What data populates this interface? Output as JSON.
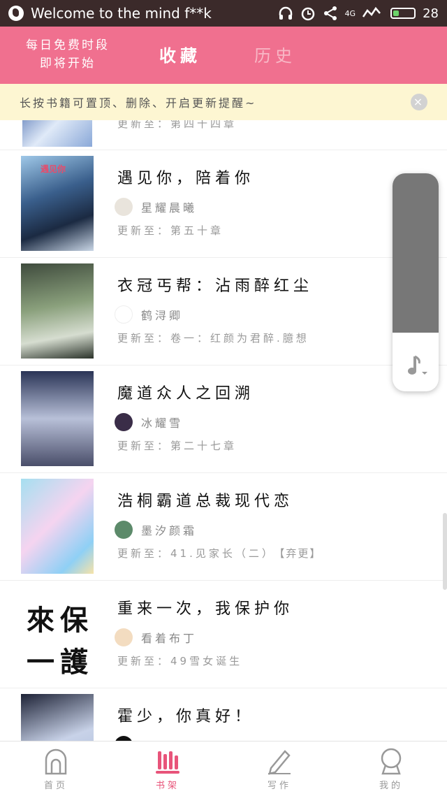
{
  "status_bar": {
    "app_text": "Welcome to the mind f**k",
    "network": "4G",
    "battery": "28"
  },
  "header": {
    "promo_line1": "每日免费时段",
    "promo_line2": "即将开始",
    "tab_favorites": "收藏",
    "tab_history": "历史"
  },
  "tip": {
    "text": "长按书籍可置顶、删除、开启更新提醒~",
    "close": "×"
  },
  "top_partial": {
    "update": "更新至：第四十四章"
  },
  "books": [
    {
      "title": "遇见你，陪着你",
      "author": "星耀晨曦",
      "update": "更新至：第五十章",
      "tag": "",
      "cover_text": "遇见你"
    },
    {
      "title": "衣冠丐帮：沾雨醉红尘",
      "author": "鹤浔卿",
      "update": "更新至：卷一：红颜为君醉.臆想",
      "tag": "",
      "cover_text": ""
    },
    {
      "title": "魔道众人之回溯",
      "author": "冰耀雪",
      "update": "更新至：第二十七章",
      "tag": "",
      "cover_text": ""
    },
    {
      "title": "浩桐霸道总裁现代恋",
      "author": "墨汐颜霜",
      "update": "更新至：41.见家长（二）",
      "tag": "【弃更】",
      "cover_text": ""
    },
    {
      "title": "重来一次，我保护你",
      "author": "看着布丁",
      "update": "更新至：49雪女诞生",
      "tag": "",
      "cover_text": ""
    },
    {
      "title": "霍少，你真好！",
      "author": "",
      "update": "",
      "tag": "",
      "cover_text": ""
    }
  ],
  "cover5_chars": [
    "來",
    "保",
    "一",
    "護"
  ],
  "float_panel": {
    "icon": "music-note-icon"
  },
  "nav": {
    "home": "首页",
    "bookshelf": "书架",
    "write": "写作",
    "mine": "我的"
  },
  "colors": {
    "accent": "#f0708f",
    "status_bar": "#3b2a2a",
    "tip_bg": "#fdf6d2",
    "nav_active": "#e8547a"
  }
}
